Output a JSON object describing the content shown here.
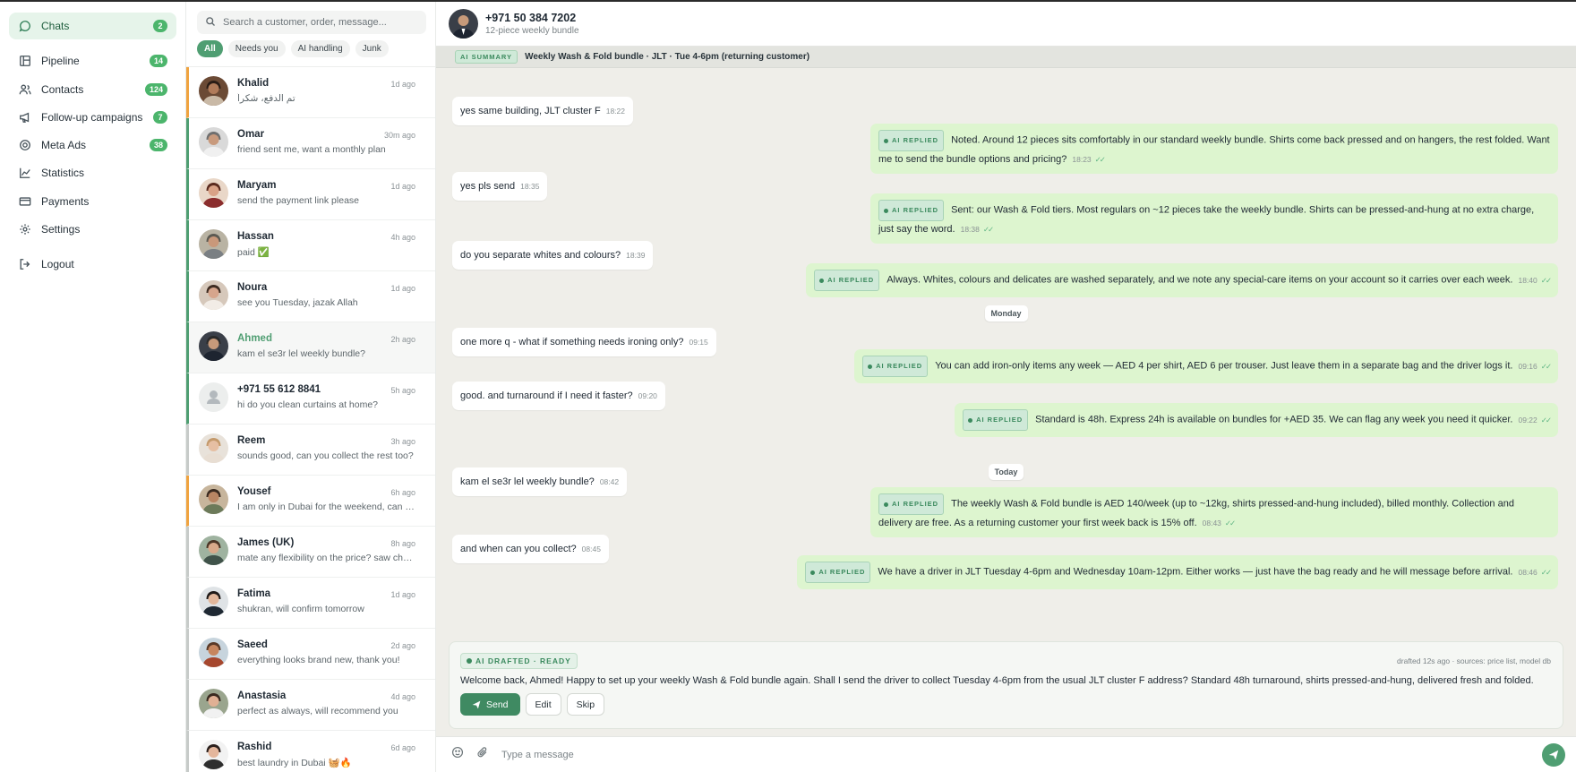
{
  "sidebar": {
    "items": [
      {
        "label": "Chats",
        "badge": "2",
        "icon": "chat-bubble-icon"
      },
      {
        "label": "Pipeline",
        "badge": "14",
        "icon": "kanban-icon"
      },
      {
        "label": "Contacts",
        "badge": "124",
        "icon": "users-icon"
      },
      {
        "label": "Follow-up campaigns",
        "badge": "7",
        "icon": "megaphone-icon"
      },
      {
        "label": "Meta Ads",
        "badge": "38",
        "icon": "target-icon"
      },
      {
        "label": "Statistics",
        "badge": "",
        "icon": "chart-icon"
      },
      {
        "label": "Payments",
        "badge": "",
        "icon": "card-icon"
      },
      {
        "label": "Settings",
        "badge": "",
        "icon": "gear-icon"
      }
    ],
    "logout": "Logout"
  },
  "list": {
    "search_placeholder": "Search a customer, order, message...",
    "filters": [
      "All",
      "Needs you",
      "AI handling",
      "Junk"
    ],
    "chats": [
      {
        "name": "Khalid",
        "preview": "تم الدفع، شكراً",
        "time": "1d ago"
      },
      {
        "name": "Omar",
        "preview": "friend sent me, want a monthly plan",
        "time": "30m ago"
      },
      {
        "name": "Maryam",
        "preview": "send the payment link please",
        "time": "1d ago"
      },
      {
        "name": "Hassan",
        "preview": "paid ✅",
        "time": "4h ago"
      },
      {
        "name": "Noura",
        "preview": "see you Tuesday, jazak Allah",
        "time": "1d ago"
      },
      {
        "name": "Ahmed",
        "preview": "kam el se3r lel weekly bundle?",
        "time": "2h ago"
      },
      {
        "name": "+971 55 612 8841",
        "preview": "hi do you clean curtains at home?",
        "time": "5h ago"
      },
      {
        "name": "Reem",
        "preview": "sounds good, can you collect the rest too?",
        "time": "3h ago"
      },
      {
        "name": "Yousef",
        "preview": "I am only in Dubai for the weekend, can it ...",
        "time": "6h ago"
      },
      {
        "name": "James (UK)",
        "preview": "mate any flexibility on the price? saw chea...",
        "time": "8h ago"
      },
      {
        "name": "Fatima",
        "preview": "shukran, will confirm tomorrow",
        "time": "1d ago"
      },
      {
        "name": "Saeed",
        "preview": "everything looks brand new, thank you!",
        "time": "2d ago"
      },
      {
        "name": "Anastasia",
        "preview": "perfect as always, will recommend you",
        "time": "4d ago"
      },
      {
        "name": "Rashid",
        "preview": "best laundry in Dubai 🧺🔥",
        "time": "6d ago"
      }
    ]
  },
  "conversation": {
    "phone": "+971 50 384 7202",
    "subtitle": "12-piece weekly bundle",
    "summary_tag": "AI SUMMARY",
    "summary": "Weekly Wash & Fold bundle · JLT · Tue 4-6pm (returning customer)",
    "ai_tag": "AI REPLIED",
    "messages": [
      {
        "dir": "in",
        "text": "yes same building, JLT cluster F",
        "time": "18:22"
      },
      {
        "dir": "out",
        "text": "Noted. Around 12 pieces sits comfortably in our standard weekly bundle. Shirts come back pressed and on hangers, the rest folded. Want me to send the bundle options and pricing?",
        "time": "18:23"
      },
      {
        "dir": "in",
        "text": "yes pls send",
        "time": "18:35"
      },
      {
        "dir": "out",
        "text": "Sent: our Wash & Fold tiers. Most regulars on ~12 pieces take the weekly bundle. Shirts can be pressed-and-hung at no extra charge, just say the word.",
        "time": "18:38"
      },
      {
        "dir": "in",
        "text": "do you separate whites and colours?",
        "time": "18:39"
      },
      {
        "dir": "out",
        "text": "Always. Whites, colours and delicates are washed separately, and we note any special-care items on your account so it carries over each week.",
        "time": "18:40"
      },
      {
        "dir": "day",
        "text": "Monday"
      },
      {
        "dir": "in",
        "text": "one more q - what if something needs ironing only?",
        "time": "09:15"
      },
      {
        "dir": "out",
        "text": "You can add iron-only items any week — AED 4 per shirt, AED 6 per trouser. Just leave them in a separate bag and the driver logs it.",
        "time": "09:16"
      },
      {
        "dir": "in",
        "text": "good. and turnaround if I need it faster?",
        "time": "09:20"
      },
      {
        "dir": "out",
        "text": "Standard is 48h. Express 24h is available on bundles for +AED 35. We can flag any week you need it quicker.",
        "time": "09:22"
      },
      {
        "dir": "day",
        "text": "Today"
      },
      {
        "dir": "in",
        "text": "kam el se3r lel weekly bundle?",
        "time": "08:42"
      },
      {
        "dir": "out",
        "text": "The weekly Wash & Fold bundle is AED 140/week (up to ~12kg, shirts pressed-and-hung included), billed monthly. Collection and delivery are free. As a returning customer your first week back is 15% off.",
        "time": "08:43"
      },
      {
        "dir": "in",
        "text": "and when can you collect?",
        "time": "08:45"
      },
      {
        "dir": "out",
        "text": "We have a driver in JLT Tuesday 4-6pm and Wednesday 10am-12pm. Either works — just have the bag ready and he will message before arrival.",
        "time": "08:46"
      }
    ]
  },
  "draft": {
    "tag": "AI DRAFTED · READY",
    "meta": "drafted 12s ago · sources: price list, model db",
    "text": "Welcome back, Ahmed! Happy to set up your weekly Wash & Fold bundle again. Shall I send the driver to collect Tuesday 4-6pm from the usual JLT cluster F address? Standard 48h turnaround, shirts pressed-and-hung, delivered fresh and folded.",
    "send": "Send",
    "edit": "Edit",
    "skip": "Skip"
  },
  "compose": {
    "placeholder": "Type a message"
  },
  "colors": {
    "accent": "#4f9e72",
    "bubble_out": "#ddf5cf",
    "chat_bg": "#efeee9"
  }
}
